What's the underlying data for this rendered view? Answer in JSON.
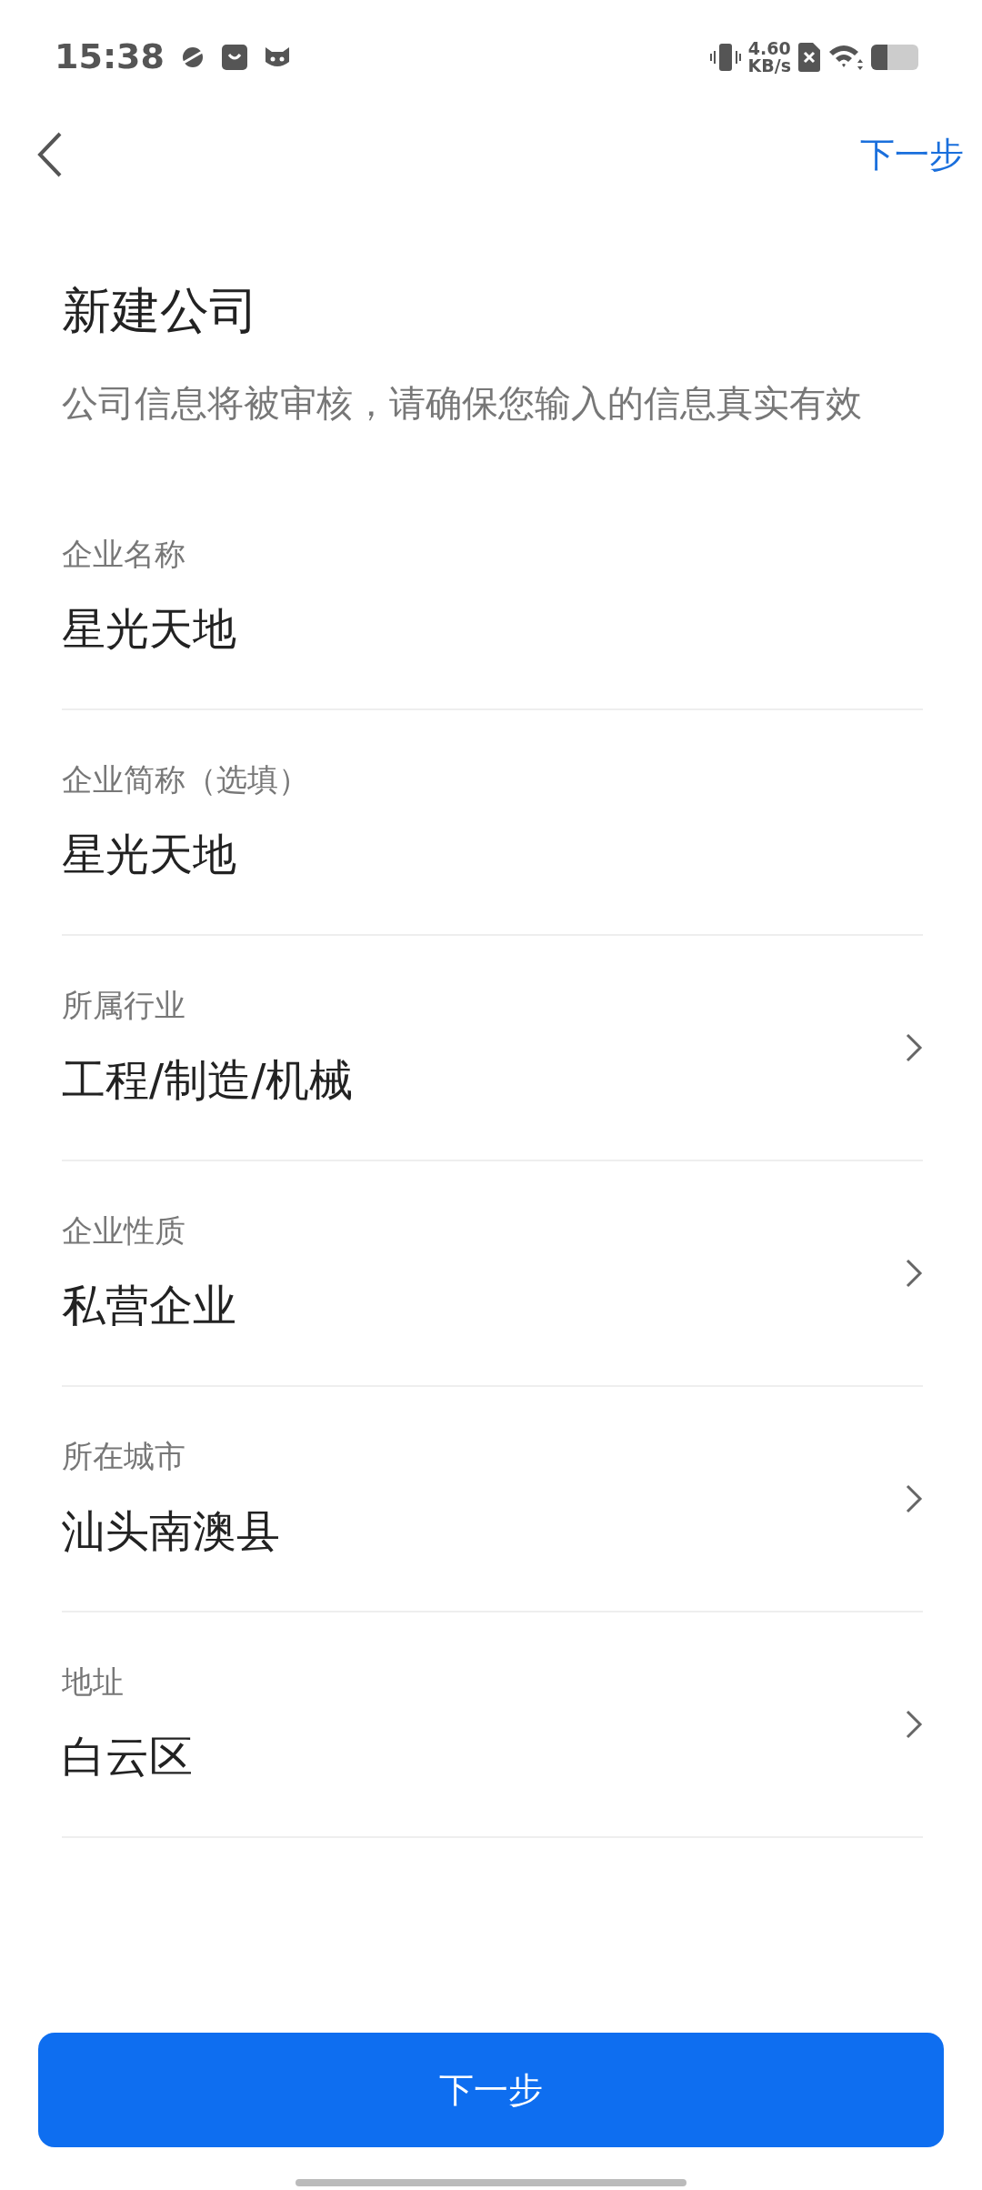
{
  "status_bar": {
    "time": "15:38",
    "speed_value": "4.60",
    "speed_unit": "KB/s"
  },
  "nav": {
    "next_link": "下一步"
  },
  "heading": {
    "title": "新建公司",
    "subtitle": "公司信息将被审核，请确保您输入的信息真实有效"
  },
  "fields": [
    {
      "label": "企业名称",
      "value": "星光天地",
      "kind": "text"
    },
    {
      "label": "企业简称（选填）",
      "value": "星光天地",
      "kind": "text"
    },
    {
      "label": "所属行业",
      "value": "工程/制造/机械",
      "kind": "select"
    },
    {
      "label": "企业性质",
      "value": "私营企业",
      "kind": "select"
    },
    {
      "label": "所在城市",
      "value": "汕头南澳县",
      "kind": "select"
    },
    {
      "label": "地址",
      "value": "白云区",
      "kind": "select"
    }
  ],
  "submit_button": "下一步"
}
